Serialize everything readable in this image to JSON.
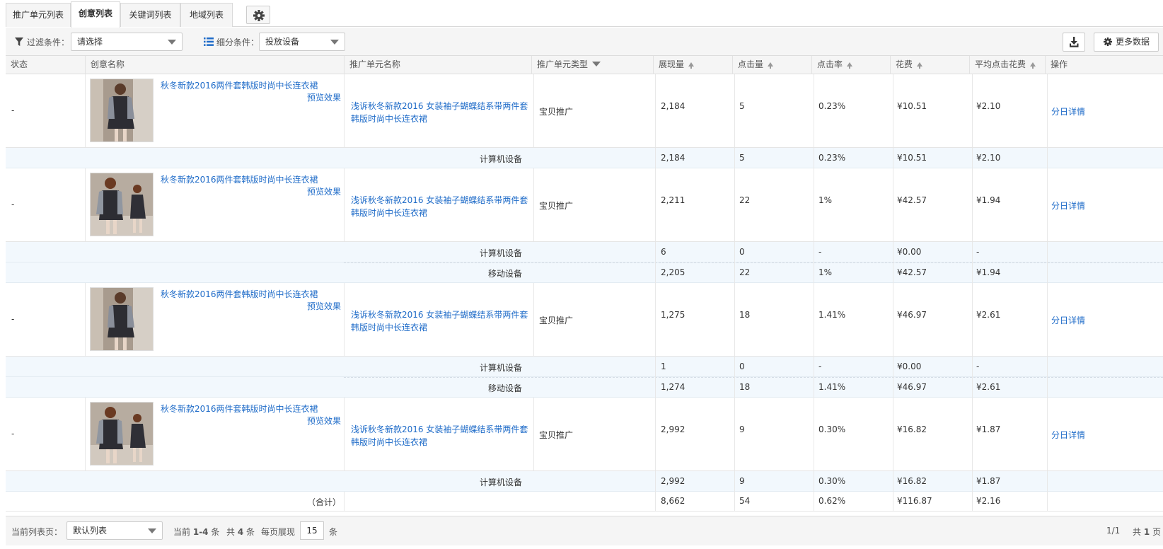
{
  "tabs": [
    "推广单元列表",
    "创意列表",
    "关键词列表",
    "地域列表"
  ],
  "active_tab": 1,
  "toolbar": {
    "filter_label": "过滤条件：",
    "filter_value": "请选择",
    "segment_label": "细分条件：",
    "segment_value": "投放设备",
    "more_data": "更多数据"
  },
  "columns": {
    "status": "状态",
    "creative": "创意名称",
    "unit": "推广单元名称",
    "unit_type": "推广单元类型",
    "impressions": "展现量",
    "clicks": "点击量",
    "ctr": "点击率",
    "cost": "花费",
    "cpc": "平均点击花费",
    "action": "操作"
  },
  "rows": [
    {
      "status": "-",
      "creative_title": "秋冬新款2016两件套韩版时尚中长连衣裙",
      "preview": "预览效果",
      "unit_name_1": "浅诉秋冬新款2016 女装袖子蝴蝶结系带两件套",
      "unit_name_2": "韩版时尚中长连衣裙",
      "unit_type": "宝贝推广",
      "impressions": "2,184",
      "clicks": "5",
      "ctr": "0.23%",
      "cost": "¥10.51",
      "cpc": "¥2.10",
      "action": "分日详情",
      "subs": [
        {
          "device": "计算机设备",
          "impressions": "2,184",
          "clicks": "5",
          "ctr": "0.23%",
          "cost": "¥10.51",
          "cpc": "¥2.10"
        }
      ]
    },
    {
      "status": "-",
      "creative_title": "秋冬新款2016两件套韩版时尚中长连衣裙",
      "preview": "预览效果",
      "unit_name_1": "浅诉秋冬新款2016 女装袖子蝴蝶结系带两件套",
      "unit_name_2": "韩版时尚中长连衣裙",
      "unit_type": "宝贝推广",
      "impressions": "2,211",
      "clicks": "22",
      "ctr": "1%",
      "cost": "¥42.57",
      "cpc": "¥1.94",
      "action": "分日详情",
      "subs": [
        {
          "device": "计算机设备",
          "impressions": "6",
          "clicks": "0",
          "ctr": "-",
          "cost": "¥0.00",
          "cpc": "-"
        },
        {
          "device": "移动设备",
          "impressions": "2,205",
          "clicks": "22",
          "ctr": "1%",
          "cost": "¥42.57",
          "cpc": "¥1.94"
        }
      ]
    },
    {
      "status": "-",
      "creative_title": "秋冬新款2016两件套韩版时尚中长连衣裙",
      "preview": "预览效果",
      "unit_name_1": "浅诉秋冬新款2016 女装袖子蝴蝶结系带两件套",
      "unit_name_2": "韩版时尚中长连衣裙",
      "unit_type": "宝贝推广",
      "impressions": "1,275",
      "clicks": "18",
      "ctr": "1.41%",
      "cost": "¥46.97",
      "cpc": "¥2.61",
      "action": "分日详情",
      "subs": [
        {
          "device": "计算机设备",
          "impressions": "1",
          "clicks": "0",
          "ctr": "-",
          "cost": "¥0.00",
          "cpc": "-"
        },
        {
          "device": "移动设备",
          "impressions": "1,274",
          "clicks": "18",
          "ctr": "1.41%",
          "cost": "¥46.97",
          "cpc": "¥2.61"
        }
      ]
    },
    {
      "status": "-",
      "creative_title": "秋冬新款2016两件套韩版时尚中长连衣裙",
      "preview": "预览效果",
      "unit_name_1": "浅诉秋冬新款2016 女装袖子蝴蝶结系带两件套",
      "unit_name_2": "韩版时尚中长连衣裙",
      "unit_type": "宝贝推广",
      "impressions": "2,992",
      "clicks": "9",
      "ctr": "0.30%",
      "cost": "¥16.82",
      "cpc": "¥1.87",
      "action": "分日详情",
      "subs": [
        {
          "device": "计算机设备",
          "impressions": "2,992",
          "clicks": "9",
          "ctr": "0.30%",
          "cost": "¥16.82",
          "cpc": "¥1.87"
        }
      ]
    }
  ],
  "total": {
    "label": "（合计）",
    "impressions": "8,662",
    "clicks": "54",
    "ctr": "0.62%",
    "cost": "¥116.87",
    "cpc": "¥2.16"
  },
  "footer": {
    "list_page_label": "当前列表页：",
    "list_page_value": "默认列表",
    "current_prefix": "当前",
    "current_range": "1-4",
    "current_suffix": "条",
    "total_prefix": "共",
    "total_count": "4",
    "total_suffix": "条",
    "per_page_label": "每页展现",
    "per_page_value": "15",
    "per_page_suffix": "条",
    "page_indicator": "1/1",
    "pages_prefix": "共",
    "pages_count": "1",
    "pages_suffix": "页"
  }
}
